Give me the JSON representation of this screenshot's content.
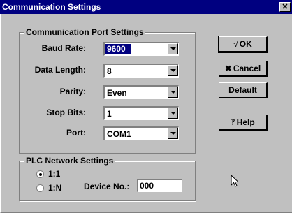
{
  "window": {
    "title": "Communication Settings",
    "close_glyph": "✕"
  },
  "port_group": {
    "title": "Communication Port Settings",
    "fields": [
      {
        "label": "Baud Rate:",
        "value": "9600"
      },
      {
        "label": "Data Length:",
        "value": "8"
      },
      {
        "label": "Parity:",
        "value": "Even"
      },
      {
        "label": "Stop Bits:",
        "value": "1"
      },
      {
        "label": "Port:",
        "value": "COM1"
      }
    ]
  },
  "buttons": {
    "ok": "OK",
    "cancel": "Cancel",
    "default": "Default",
    "help": "Help"
  },
  "network_group": {
    "title": "PLC Network Settings",
    "radio_1_1": "1:1",
    "radio_1_n": "1:N",
    "radio_selected": "1:1",
    "device_label": "Device No.:",
    "device_value": "000"
  }
}
